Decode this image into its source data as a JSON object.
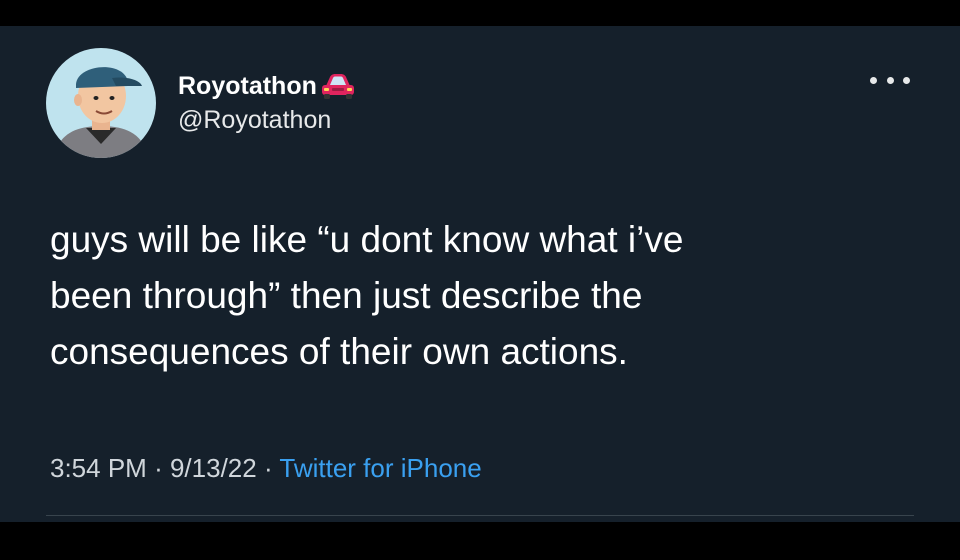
{
  "tweet": {
    "author": {
      "display_name": "Royotathon",
      "name_emoji_icon": "red-car-icon",
      "handle": "@Royotathon",
      "avatar_icon": "cartoon-avatar-icon"
    },
    "more_icon": "more-options-icon",
    "text_lines": [
      "guys will be like “u dont know what i’ve",
      "been through” then just describe the",
      "consequences of their own actions."
    ],
    "meta": {
      "time": "3:54 PM",
      "separator": "·",
      "date": "9/13/22",
      "source": "Twitter for iPhone"
    }
  },
  "colors": {
    "background": "#15202b",
    "outer_background": "#000000",
    "text": "#ffffff",
    "secondary_text": "#d0d6db",
    "link": "#3aa0f0",
    "car": "#e0245e"
  }
}
